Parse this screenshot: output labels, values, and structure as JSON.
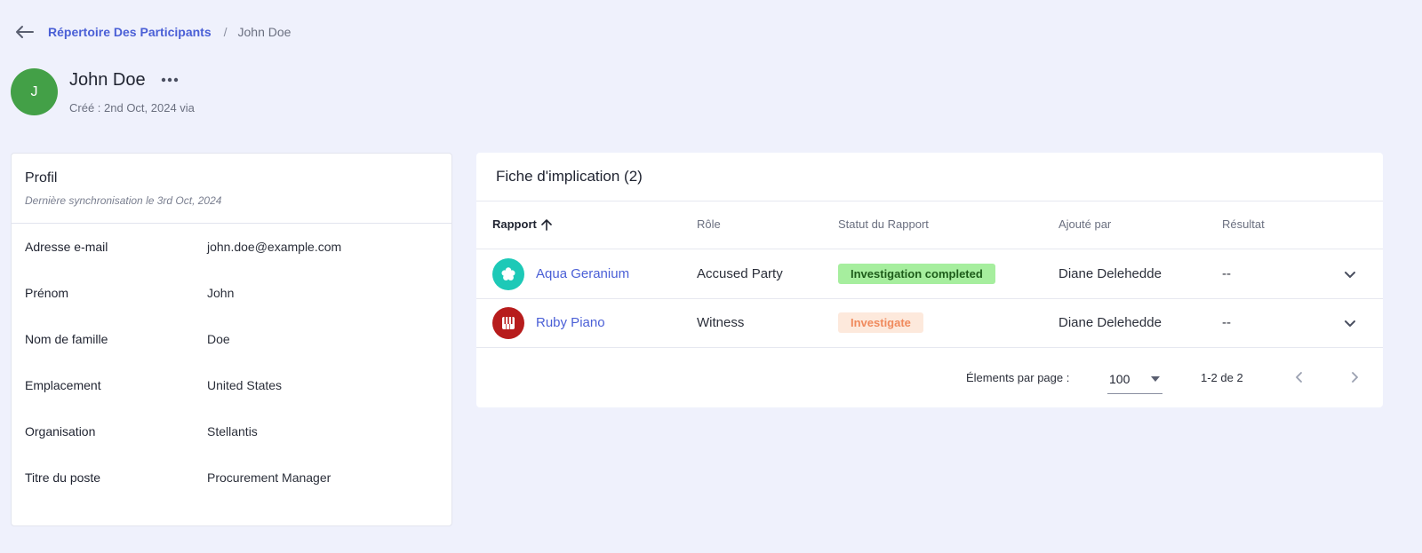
{
  "breadcrumb": {
    "parent": "Répertoire Des Participants",
    "separator": "/",
    "current": "John Doe"
  },
  "header": {
    "avatar_initial": "J",
    "name": "John Doe",
    "created": "Créé : 2nd Oct, 2024 via"
  },
  "profile": {
    "title": "Profil",
    "sync": "Dernière synchronisation le 3rd Oct, 2024",
    "fields": [
      {
        "label": "Adresse e-mail",
        "value": "john.doe@example.com"
      },
      {
        "label": "Prénom",
        "value": "John"
      },
      {
        "label": "Nom de famille",
        "value": "Doe"
      },
      {
        "label": "Emplacement",
        "value": "United States"
      },
      {
        "label": "Organisation",
        "value": "Stellantis"
      },
      {
        "label": "Titre du poste",
        "value": "Procurement Manager"
      }
    ]
  },
  "implication": {
    "title": "Fiche d'implication (2)",
    "columns": {
      "report": "Rapport",
      "role": "Rôle",
      "status": "Statut du Rapport",
      "added_by": "Ajouté par",
      "result": "Résultat"
    },
    "rows": [
      {
        "report": "Aqua Geranium",
        "role": "Accused Party",
        "status": "Investigation completed",
        "added_by": "Diane Delehedde",
        "result": "--",
        "icon": "flower-icon",
        "icon_color": "#1dc9b7",
        "status_bg": "#a6ee9e",
        "status_fg": "#1e5c1a"
      },
      {
        "report": "Ruby Piano",
        "role": "Witness",
        "status": "Investigate",
        "added_by": "Diane Delehedde",
        "result": "--",
        "icon": "piano-icon",
        "icon_color": "#b71c1c",
        "status_bg": "#fde9dc",
        "status_fg": "#f08a5d"
      }
    ]
  },
  "pagination": {
    "per_page_label": "Élements par page :",
    "per_page_value": "100",
    "range": "1-2 de 2"
  },
  "colors": {
    "accent": "#4a5fd6",
    "background": "#eff1fc",
    "avatar": "#43a047"
  }
}
